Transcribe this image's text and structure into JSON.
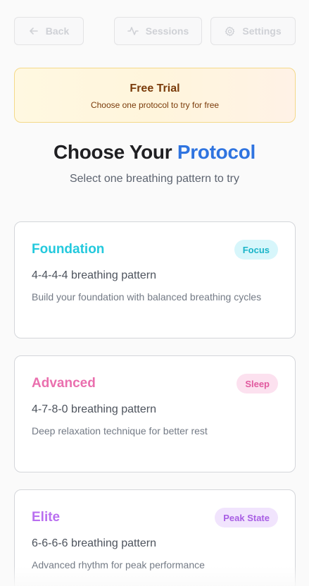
{
  "nav": {
    "back": {
      "label": "Back",
      "icon": "arrow-left-icon"
    },
    "sessions": {
      "label": "Sessions",
      "icon": "activity-icon"
    },
    "settings": {
      "label": "Settings",
      "icon": "gear-icon"
    }
  },
  "trial": {
    "title": "Free Trial",
    "subtitle": "Choose one protocol to try for free"
  },
  "heading": {
    "prefix": "Choose Your",
    "accent": "Protocol",
    "subtitle": "Select one breathing pattern to try"
  },
  "protocols": [
    {
      "name": "Foundation",
      "badge": "Focus",
      "pattern": "4-4-4-4 breathing pattern",
      "description": "Build your foundation with balanced breathing cycles",
      "color": "#23c9dd",
      "badge_bg": "#d7f6fb",
      "badge_color": "#1ab4c8"
    },
    {
      "name": "Advanced",
      "badge": "Sleep",
      "pattern": "4-7-8-0 breathing pattern",
      "description": "Deep relaxation technique for better rest",
      "color": "#ea6fae",
      "badge_bg": "#fce1ef",
      "badge_color": "#e15a9f"
    },
    {
      "name": "Elite",
      "badge": "Peak State",
      "pattern": "6-6-6-6 breathing pattern",
      "description": "Advanced rhythm for peak performance",
      "color": "#b96ff0",
      "badge_bg": "#f1e4fd",
      "badge_color": "#a85ee4"
    }
  ]
}
